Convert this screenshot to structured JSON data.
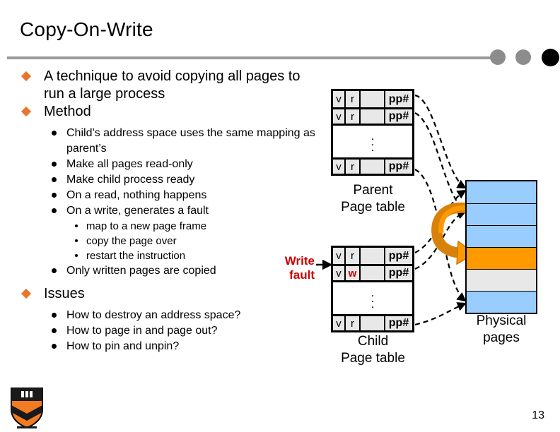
{
  "slide": {
    "title": "Copy-On-Write",
    "page_number": "13",
    "logo_name": "princeton-shield-logo"
  },
  "colors": {
    "bullet_orange": "#E8762C",
    "accent_orange": "#FF9900",
    "page_blue": "#99CCFF",
    "page_gray": "#E8E8E8",
    "fault_red": "#CC0000",
    "rule_gray": "#9A9A9A"
  },
  "bullets": [
    {
      "level": 1,
      "text": "A technique to avoid copying all pages to run a large process",
      "children": []
    },
    {
      "level": 1,
      "text": "Method",
      "children": [
        {
          "level": 2,
          "text": "Child’s address space uses the same mapping as parent’s",
          "children": []
        },
        {
          "level": 2,
          "text": "Make all pages read-only",
          "children": []
        },
        {
          "level": 2,
          "text": "Make child process ready",
          "children": []
        },
        {
          "level": 2,
          "text": "On a read, nothing happens",
          "children": []
        },
        {
          "level": 2,
          "text": "On a write, generates a fault",
          "children": [
            {
              "level": 3,
              "text": "map to a new page frame"
            },
            {
              "level": 3,
              "text": "copy the page over"
            },
            {
              "level": 3,
              "text": "restart the instruction"
            }
          ]
        },
        {
          "level": 2,
          "text": "Only written pages are copied",
          "children": []
        }
      ]
    },
    {
      "level": 1,
      "text": "Issues",
      "children": [
        {
          "level": 2,
          "text": "How to destroy an address space?",
          "children": []
        },
        {
          "level": 2,
          "text": "How to page in and page out?",
          "children": []
        },
        {
          "level": 2,
          "text": "How to pin and unpin?",
          "children": []
        }
      ]
    }
  ],
  "diagram": {
    "parent_table": {
      "label_line1": "Parent",
      "label_line2": "Page table",
      "rows": [
        {
          "valid": "v",
          "prot": "r",
          "blank": "",
          "frame": "pp#"
        },
        {
          "valid": "v",
          "prot": "r",
          "blank": "",
          "frame": "pp#"
        },
        {
          "ellipsis": "⋮"
        },
        {
          "valid": "v",
          "prot": "r",
          "blank": "",
          "frame": "pp#"
        }
      ]
    },
    "child_table": {
      "label_line1": "Child",
      "label_line2": "Page table",
      "rows": [
        {
          "valid": "v",
          "prot": "r",
          "blank": "",
          "frame": "pp#"
        },
        {
          "valid": "v",
          "prot": "w",
          "blank": "",
          "frame": "pp#",
          "prot_highlight": true
        },
        {
          "ellipsis": "⋮"
        },
        {
          "valid": "v",
          "prot": "r",
          "blank": "",
          "frame": "pp#"
        }
      ]
    },
    "write_fault": {
      "line1": "Write",
      "line2": "fault"
    },
    "physical_pages": {
      "label_line1": "Physical",
      "label_line2": "pages",
      "rows": [
        {
          "fill": "#99CCFF"
        },
        {
          "fill": "#99CCFF"
        },
        {
          "fill": "#99CCFF"
        },
        {
          "fill": "#FF9900"
        },
        {
          "fill": "#E8E8E8"
        },
        {
          "fill": "#99CCFF"
        }
      ]
    }
  }
}
